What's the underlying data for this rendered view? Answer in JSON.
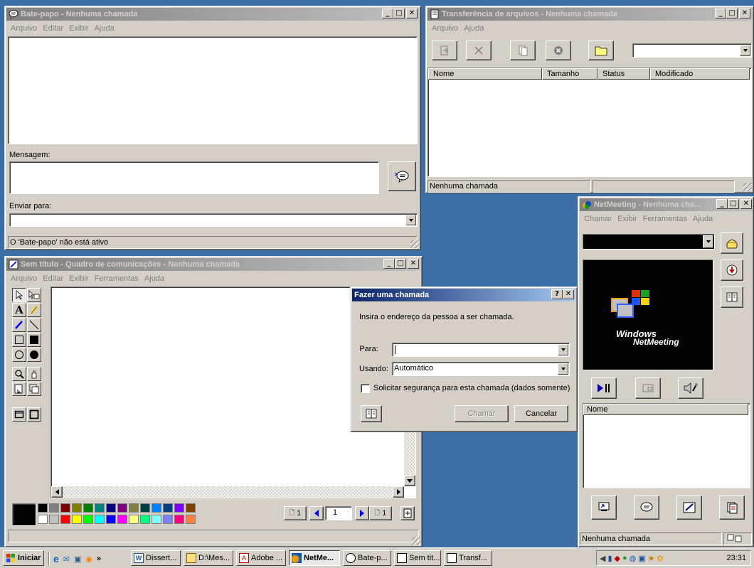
{
  "chat": {
    "title": "Bate-papo - Nenhuma chamada",
    "menu": [
      "Arquivo",
      "Editar",
      "Exibir",
      "Ajuda"
    ],
    "message_label": "Mensagem:",
    "send_to_label": "Enviar para:",
    "send_to_value": "",
    "status": "O 'Bate-papo' não está ativo"
  },
  "transfer": {
    "title": "Transferência de arquivos - Nenhuma chamada",
    "menu": [
      "Arquivo",
      "Ajuda"
    ],
    "columns": [
      "Nome",
      "Tamanho",
      "Status",
      "Modificado"
    ],
    "status": "Nenhuma chamada"
  },
  "whiteboard": {
    "title": "Sem título - Quadro de comunicações - Nenhuma chamada",
    "menu": [
      "Arquivo",
      "Editar",
      "Exibir",
      "Ferramentas",
      "Ajuda"
    ],
    "page_label": "1",
    "page_input": "1",
    "page_total_label": "1",
    "palette": [
      "#000000",
      "#808080",
      "#800000",
      "#808000",
      "#008000",
      "#008080",
      "#000080",
      "#800080",
      "#808040",
      "#004040",
      "#0080ff",
      "#004080",
      "#8000ff",
      "#804000",
      "#ffffff",
      "#c0c0c0",
      "#ff0000",
      "#ffff00",
      "#00ff00",
      "#00ffff",
      "#0000ff",
      "#ff00ff",
      "#ffff80",
      "#00ff80",
      "#80ffff",
      "#8080ff",
      "#ff0080",
      "#ff8040"
    ]
  },
  "dialog": {
    "title": "Fazer uma chamada",
    "instruction": "Insira o endereço da pessoa a ser chamada.",
    "to_label": "Para:",
    "to_value": "",
    "using_label": "Usando:",
    "using_value": "Automático",
    "secure_label": "Solicitar segurança para esta chamada (dados somente)",
    "call_button": "Chamar",
    "cancel_button": "Cancelar"
  },
  "netmeeting": {
    "title": "NetMeeting - Nenhuma cha...",
    "menu": [
      "Chamar",
      "Exibir",
      "Ferramentas",
      "Ajuda"
    ],
    "logo_line1": "Windows",
    "logo_line2": "NetMeeting",
    "list_header": "Nome",
    "status": "Nenhuma chamada"
  },
  "taskbar": {
    "start": "Iniciar",
    "tasks": [
      "Dissert...",
      "D:\\Mes...",
      "Adobe ...",
      "NetMe...",
      "Bate-p...",
      "Sem tit...",
      "Transf..."
    ],
    "clock": "23:31"
  }
}
